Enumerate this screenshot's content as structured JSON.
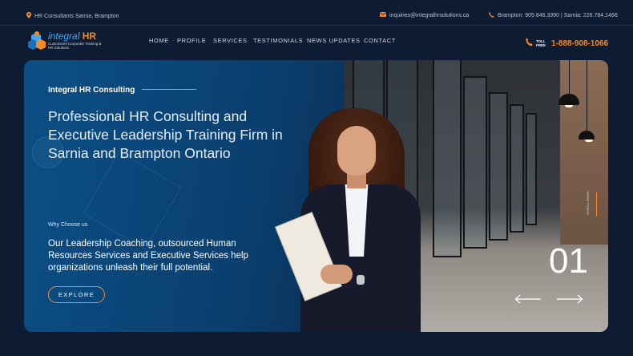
{
  "topbar": {
    "location": "HR Consultants Sarnia, Brampton",
    "email": "inquiries@integralhrsolutions.ca",
    "phones": "Brampton: 905.846.3390  |  Sarnia: 226.784.1466"
  },
  "logo": {
    "name_part1": "integral",
    "name_part2": "HR",
    "tagline": "Customized Corporate Training & HR Solutions"
  },
  "nav": {
    "items": [
      "HOME",
      "PROFILE",
      "SERVICES",
      "TESTIMONIALS",
      "NEWS UPDATES",
      "CONTACT"
    ]
  },
  "phone": {
    "toll_label_1": "TOLL",
    "toll_label_2": "FREE",
    "number": "1-888-908-1066"
  },
  "hero": {
    "eyebrow": "Integral HR Consulting",
    "headline": "Professional HR Consulting and Executive Leadership Training Firm in Sarnia and Brampton Ontario",
    "why_label": "Why Choose us",
    "description": "Our Leadership Coaching, outsourced Human Resources Services and Executive Services help organizations unleash their full potential.",
    "explore_label": "EXPLORE",
    "slide_number": "01",
    "scroll_label": "SCROLL DOWN"
  },
  "colors": {
    "accent": "#f28c28",
    "background": "#0d1b33",
    "hero_blue": "#0b4f86"
  },
  "icons": [
    "location-pin-icon",
    "envelope-icon",
    "phone-icon",
    "arrow-left-icon",
    "arrow-right-icon"
  ]
}
